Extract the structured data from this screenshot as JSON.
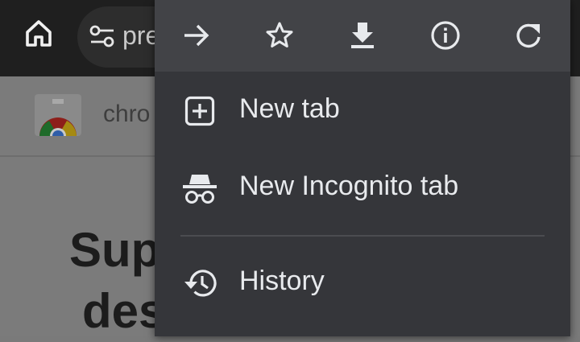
{
  "toolbar": {
    "home_icon": "home-icon",
    "site_settings_icon": "tune-icon",
    "url_fragment": "pre"
  },
  "page": {
    "site_name": "chro",
    "heading_line1": "Sup",
    "heading_line2": "des"
  },
  "menu": {
    "actions": [
      {
        "name": "forward",
        "icon": "arrow-forward-icon"
      },
      {
        "name": "bookmark",
        "icon": "star-outline-icon"
      },
      {
        "name": "download",
        "icon": "download-icon"
      },
      {
        "name": "page-info",
        "icon": "info-icon"
      },
      {
        "name": "reload",
        "icon": "refresh-icon"
      }
    ],
    "items": [
      {
        "label": "New tab",
        "icon": "add-box-icon"
      },
      {
        "label": "New Incognito tab",
        "icon": "incognito-icon"
      },
      {
        "label": "History",
        "icon": "history-icon"
      }
    ]
  },
  "colors": {
    "menu_bg": "#35363a",
    "menu_action_bar": "#424347",
    "toolbar_bg": "#1f1f1f",
    "menu_text": "#e8eaed"
  }
}
